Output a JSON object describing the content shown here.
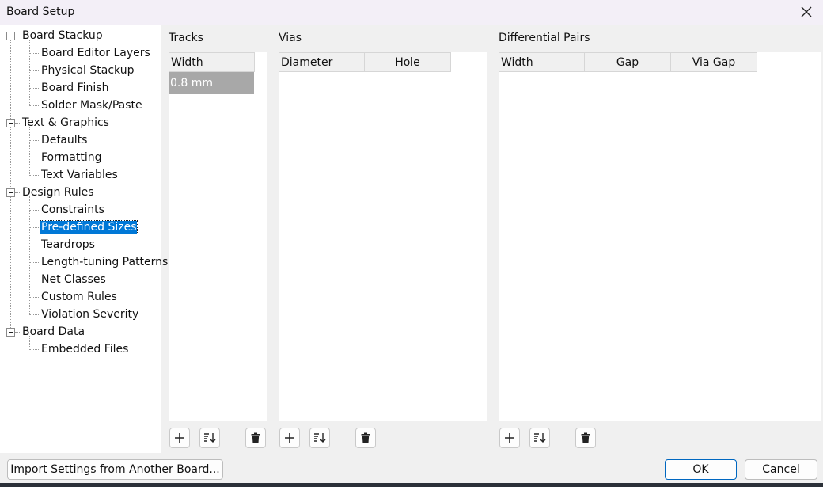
{
  "window": {
    "title": "Board Setup"
  },
  "tree": {
    "groups": [
      {
        "label": "Board Stackup",
        "children": [
          "Board Editor Layers",
          "Physical Stackup",
          "Board Finish",
          "Solder Mask/Paste"
        ]
      },
      {
        "label": "Text & Graphics",
        "children": [
          "Defaults",
          "Formatting",
          "Text Variables"
        ]
      },
      {
        "label": "Design Rules",
        "children": [
          "Constraints",
          "Pre-defined Sizes",
          "Teardrops",
          "Length-tuning Patterns",
          "Net Classes",
          "Custom Rules",
          "Violation Severity"
        ]
      },
      {
        "label": "Board Data",
        "children": [
          "Embedded Files"
        ]
      }
    ],
    "selected": "Pre-defined Sizes"
  },
  "tracks": {
    "title": "Tracks",
    "columns": [
      "Width"
    ],
    "rows": [
      "0.8 mm"
    ]
  },
  "vias": {
    "title": "Vias",
    "columns": [
      "Diameter",
      "Hole"
    ],
    "rows": []
  },
  "diff_pairs": {
    "title": "Differential Pairs",
    "columns": [
      "Width",
      "Gap",
      "Via Gap"
    ],
    "rows": []
  },
  "icons": {
    "add": "plus-icon",
    "sort": "sort-icon",
    "delete": "trash-icon",
    "close": "close-icon"
  },
  "footer": {
    "import_label": "Import Settings from Another Board...",
    "ok_label": "OK",
    "cancel_label": "Cancel"
  },
  "colors": {
    "selection": "#0078d7",
    "grid_selection": "#a8a8a8",
    "accent_border": "#0067c0"
  }
}
